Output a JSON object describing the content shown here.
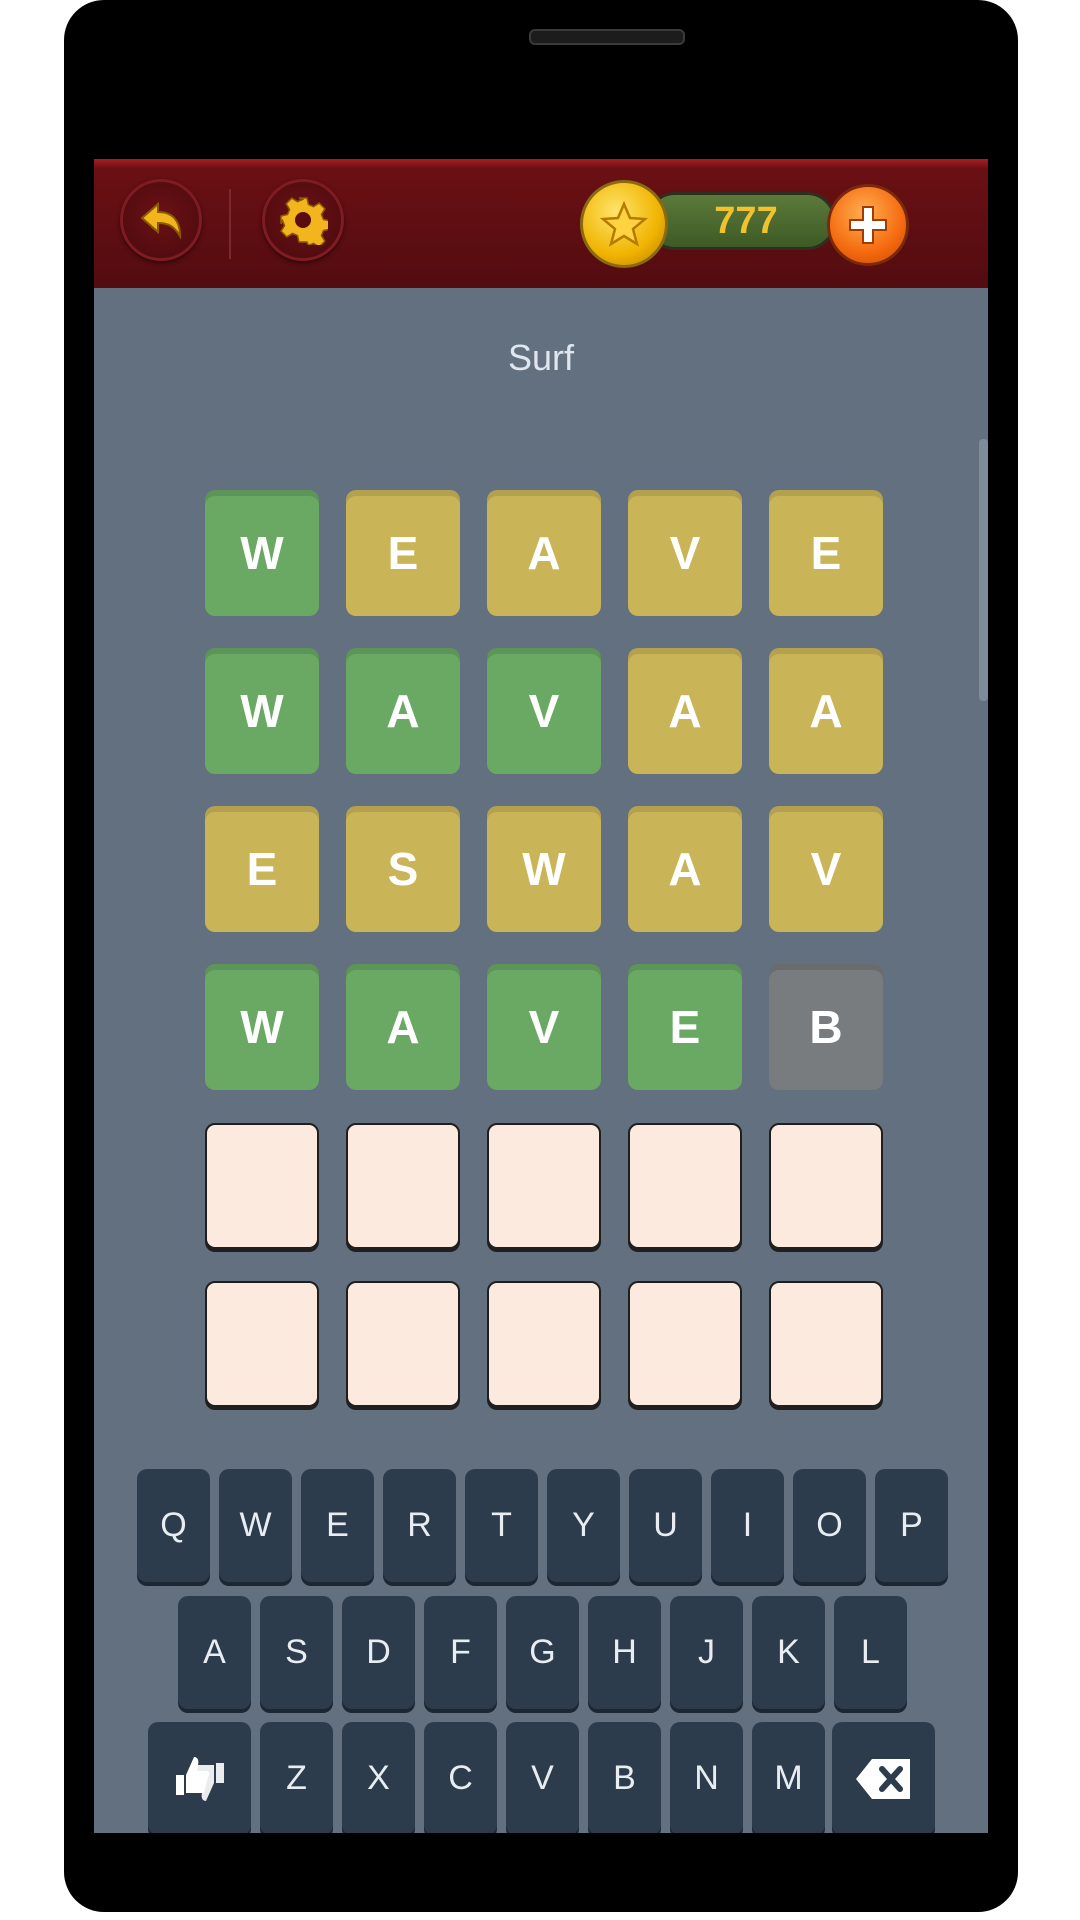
{
  "header": {
    "back_icon": "back-arrow-icon",
    "settings_icon": "gear-icon",
    "coins": "777",
    "coin_icon": "star-coin-icon",
    "add_coins_icon": "plus-icon"
  },
  "hint": "Surf",
  "colors": {
    "correct": "#6aa964",
    "present": "#c9b458",
    "absent": "#787c7f",
    "empty": "#fdeade"
  },
  "board": [
    [
      {
        "letter": "W",
        "state": "correct"
      },
      {
        "letter": "E",
        "state": "present"
      },
      {
        "letter": "A",
        "state": "present"
      },
      {
        "letter": "V",
        "state": "present"
      },
      {
        "letter": "E",
        "state": "present"
      }
    ],
    [
      {
        "letter": "W",
        "state": "correct"
      },
      {
        "letter": "A",
        "state": "correct"
      },
      {
        "letter": "V",
        "state": "correct"
      },
      {
        "letter": "A",
        "state": "present"
      },
      {
        "letter": "A",
        "state": "present"
      }
    ],
    [
      {
        "letter": "E",
        "state": "present"
      },
      {
        "letter": "S",
        "state": "present"
      },
      {
        "letter": "W",
        "state": "present"
      },
      {
        "letter": "A",
        "state": "present"
      },
      {
        "letter": "V",
        "state": "present"
      }
    ],
    [
      {
        "letter": "W",
        "state": "correct"
      },
      {
        "letter": "A",
        "state": "correct"
      },
      {
        "letter": "V",
        "state": "correct"
      },
      {
        "letter": "E",
        "state": "correct"
      },
      {
        "letter": "B",
        "state": "absent"
      }
    ],
    [
      {
        "letter": "",
        "state": "empty"
      },
      {
        "letter": "",
        "state": "empty"
      },
      {
        "letter": "",
        "state": "empty"
      },
      {
        "letter": "",
        "state": "empty"
      },
      {
        "letter": "",
        "state": "empty"
      }
    ],
    [
      {
        "letter": "",
        "state": "empty"
      },
      {
        "letter": "",
        "state": "empty"
      },
      {
        "letter": "",
        "state": "empty"
      },
      {
        "letter": "",
        "state": "empty"
      },
      {
        "letter": "",
        "state": "empty"
      }
    ]
  ],
  "keyboard": {
    "row1": [
      "Q",
      "W",
      "E",
      "R",
      "T",
      "Y",
      "U",
      "I",
      "O",
      "P"
    ],
    "row2": [
      "A",
      "S",
      "D",
      "F",
      "G",
      "H",
      "J",
      "K",
      "L"
    ],
    "row3": [
      "Z",
      "X",
      "C",
      "V",
      "B",
      "N",
      "M"
    ],
    "left_special_icon": "thumbs-up-down-icon",
    "right_special_icon": "backspace-icon"
  }
}
